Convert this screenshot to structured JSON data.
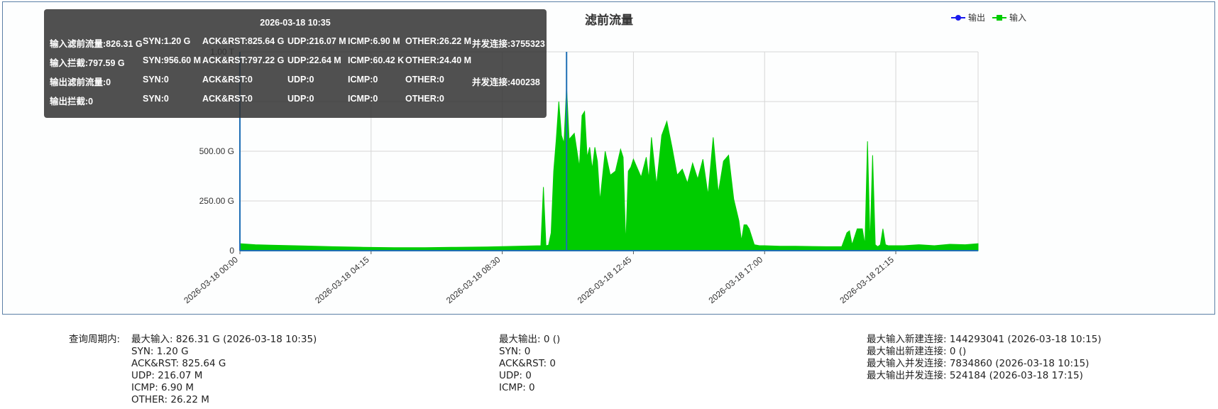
{
  "chart_data": {
    "type": "area",
    "title": "滤前流量",
    "xlabel": "",
    "ylabel": "",
    "ylim": [
      0,
      1000
    ],
    "y_unit": "G",
    "y_ticks": [
      "0",
      "250.00 G",
      "500.00 G",
      "1.00 T"
    ],
    "y_tick_values": [
      0,
      250,
      500,
      1000
    ],
    "x_range": [
      "2026-03-18 00:00",
      "2026-03-18 23:55"
    ],
    "x_ticks": [
      "2026-03-18 00:00",
      "2026-03-18 04:15",
      "2026-03-18 08:30",
      "2026-03-18 12:45",
      "2026-03-18 17:00",
      "2026-03-18 21:15"
    ],
    "grid": true,
    "legend_position": "top-right",
    "legend": [
      "输出",
      "输入"
    ],
    "crosshair_time": "2026-03-18 10:35",
    "series": [
      {
        "name": "输出",
        "color": "#1a1aee",
        "x": [
          "2026-03-18 00:00",
          "2026-03-18 23:55"
        ],
        "values": [
          0,
          0
        ]
      },
      {
        "name": "输入",
        "color": "#00cc00",
        "x": [
          "2026-03-18 00:00",
          "2026-03-18 00:30",
          "2026-03-18 01:00",
          "2026-03-18 02:00",
          "2026-03-18 03:00",
          "2026-03-18 04:00",
          "2026-03-18 05:00",
          "2026-03-18 06:00",
          "2026-03-18 07:00",
          "2026-03-18 08:00",
          "2026-03-18 09:00",
          "2026-03-18 09:45",
          "2026-03-18 09:50",
          "2026-03-18 09:55",
          "2026-03-18 10:00",
          "2026-03-18 10:05",
          "2026-03-18 10:10",
          "2026-03-18 10:15",
          "2026-03-18 10:20",
          "2026-03-18 10:25",
          "2026-03-18 10:30",
          "2026-03-18 10:35",
          "2026-03-18 10:40",
          "2026-03-18 10:50",
          "2026-03-18 11:00",
          "2026-03-18 11:05",
          "2026-03-18 11:10",
          "2026-03-18 11:15",
          "2026-03-18 11:20",
          "2026-03-18 11:25",
          "2026-03-18 11:30",
          "2026-03-18 11:35",
          "2026-03-18 11:40",
          "2026-03-18 11:50",
          "2026-03-18 12:00",
          "2026-03-18 12:10",
          "2026-03-18 12:20",
          "2026-03-18 12:25",
          "2026-03-18 12:30",
          "2026-03-18 12:35",
          "2026-03-18 12:40",
          "2026-03-18 12:45",
          "2026-03-18 12:50",
          "2026-03-18 13:00",
          "2026-03-18 13:10",
          "2026-03-18 13:15",
          "2026-03-18 13:20",
          "2026-03-18 13:30",
          "2026-03-18 13:40",
          "2026-03-18 13:50",
          "2026-03-18 14:00",
          "2026-03-18 14:10",
          "2026-03-18 14:20",
          "2026-03-18 14:30",
          "2026-03-18 14:40",
          "2026-03-18 14:50",
          "2026-03-18 15:00",
          "2026-03-18 15:10",
          "2026-03-18 15:20",
          "2026-03-18 15:30",
          "2026-03-18 15:40",
          "2026-03-18 15:50",
          "2026-03-18 16:00",
          "2026-03-18 16:10",
          "2026-03-18 16:15",
          "2026-03-18 16:20",
          "2026-03-18 16:25",
          "2026-03-18 16:30",
          "2026-03-18 16:40",
          "2026-03-18 16:50",
          "2026-03-18 17:00",
          "2026-03-18 17:30",
          "2026-03-18 18:00",
          "2026-03-18 19:00",
          "2026-03-18 19:30",
          "2026-03-18 19:40",
          "2026-03-18 19:45",
          "2026-03-18 19:50",
          "2026-03-18 20:00",
          "2026-03-18 20:10",
          "2026-03-18 20:15",
          "2026-03-18 20:20",
          "2026-03-18 20:25",
          "2026-03-18 20:30",
          "2026-03-18 20:35",
          "2026-03-18 20:40",
          "2026-03-18 20:45",
          "2026-03-18 20:50",
          "2026-03-18 20:55",
          "2026-03-18 21:00",
          "2026-03-18 21:30",
          "2026-03-18 22:00",
          "2026-03-18 22:30",
          "2026-03-18 23:00",
          "2026-03-18 23:30",
          "2026-03-18 23:55"
        ],
        "values": [
          35,
          30,
          28,
          24,
          20,
          17,
          15,
          15,
          17,
          19,
          22,
          25,
          320,
          25,
          28,
          90,
          400,
          560,
          750,
          580,
          540,
          827,
          560,
          590,
          420,
          680,
          700,
          470,
          520,
          410,
          520,
          450,
          250,
          500,
          380,
          400,
          510,
          470,
          30,
          400,
          420,
          460,
          430,
          370,
          470,
          360,
          570,
          330,
          580,
          650,
          520,
          380,
          410,
          340,
          440,
          360,
          460,
          280,
          570,
          290,
          450,
          480,
          260,
          150,
          50,
          130,
          130,
          110,
          30,
          25,
          25,
          22,
          22,
          20,
          20,
          90,
          100,
          30,
          110,
          110,
          30,
          550,
          30,
          480,
          30,
          20,
          30,
          110,
          30,
          25,
          25,
          30,
          25,
          32,
          30,
          35
        ]
      }
    ]
  },
  "tooltip": {
    "title": "2026-03-18 10:35",
    "rows": [
      [
        "输入滤前流量:826.31 G",
        "SYN:1.20 G",
        "ACK&RST:825.64 G",
        "UDP:216.07 M",
        "ICMP:6.90 M",
        "OTHER:26.22 M",
        "并发连接:3755323"
      ],
      [
        "输入拦截:797.59 G",
        "SYN:956.60 M",
        "ACK&RST:797.22 G",
        "UDP:22.64 M",
        "ICMP:60.42 K",
        "OTHER:24.40 M",
        ""
      ],
      [
        "输出滤前流量:0",
        "SYN:0",
        "ACK&RST:0",
        "UDP:0",
        "ICMP:0",
        "OTHER:0",
        "并发连接:400238"
      ],
      [
        "输出拦截:0",
        "SYN:0",
        "ACK&RST:0",
        "UDP:0",
        "ICMP:0",
        "OTHER:0",
        ""
      ]
    ]
  },
  "summary": {
    "period_label": "查询周期内:",
    "col1": [
      "最大输入: 826.31 G (2026-03-18 10:35)",
      "SYN: 1.20 G",
      "ACK&RST: 825.64 G",
      "UDP: 216.07 M",
      "ICMP: 6.90 M",
      "OTHER: 26.22 M"
    ],
    "col2": [
      "最大输出: 0 ()",
      "SYN: 0",
      "ACK&RST: 0",
      "UDP: 0",
      "ICMP: 0"
    ],
    "col3": [
      "最大输入新建连接: 144293041 (2026-03-18 10:15)",
      "最大输出新建连接: 0 ()",
      "最大输入并发连接: 7834860 (2026-03-18 10:15)",
      "最大输出并发连接: 524184 (2026-03-18 17:15)"
    ]
  }
}
